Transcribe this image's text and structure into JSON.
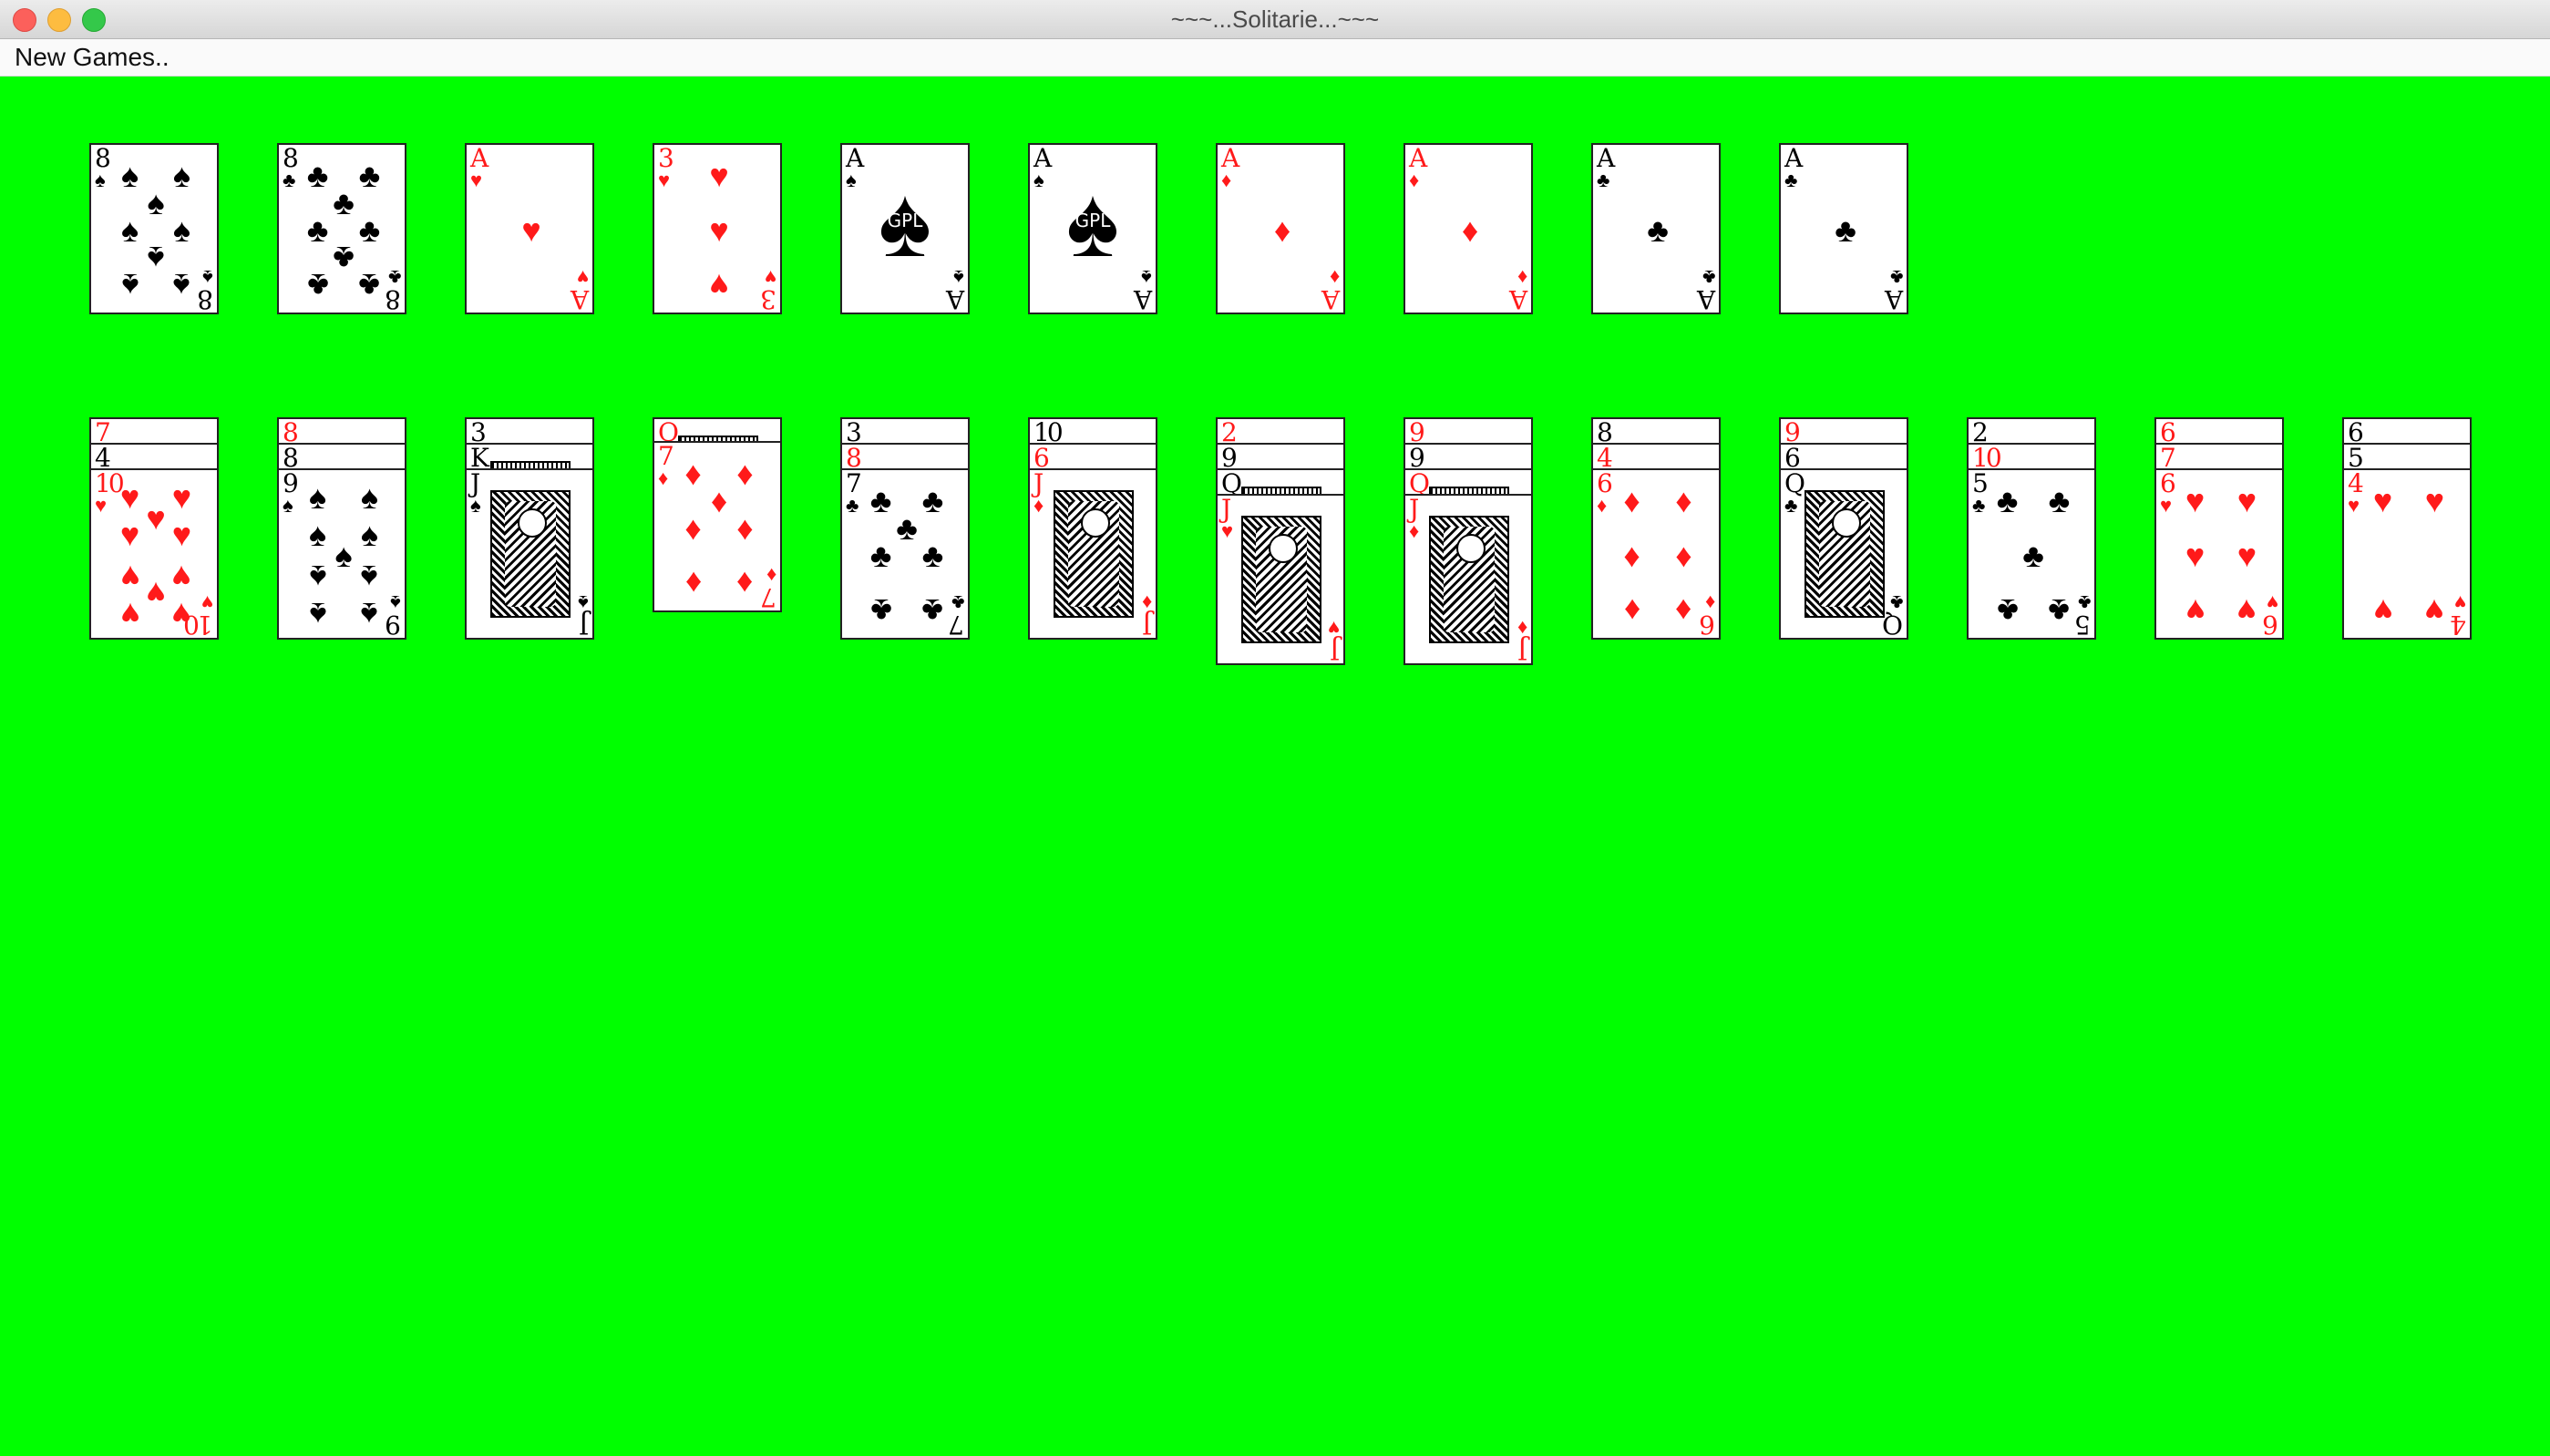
{
  "window": {
    "title": "~~~...Solitarie...~~~"
  },
  "menu": {
    "new_games": "New Games.."
  },
  "colors": {
    "felt": "#00ff00",
    "red_suit": "#ff1a1a",
    "black_suit": "#000000"
  },
  "top_row": [
    {
      "rank": "8",
      "suit": "spades"
    },
    {
      "rank": "8",
      "suit": "clubs"
    },
    {
      "rank": "A",
      "suit": "hearts"
    },
    {
      "rank": "3",
      "suit": "hearts"
    },
    {
      "rank": "A",
      "suit": "spades",
      "logo": "GPL"
    },
    {
      "rank": "A",
      "suit": "spades",
      "logo": "GPL"
    },
    {
      "rank": "A",
      "suit": "diamonds"
    },
    {
      "rank": "A",
      "suit": "diamonds"
    },
    {
      "rank": "A",
      "suit": "clubs"
    },
    {
      "rank": "A",
      "suit": "clubs"
    }
  ],
  "tableau": [
    [
      {
        "rank": "7",
        "suit": "hearts"
      },
      {
        "rank": "4",
        "suit": "spades"
      },
      {
        "rank": "10",
        "suit": "hearts"
      }
    ],
    [
      {
        "rank": "8",
        "suit": "diamonds"
      },
      {
        "rank": "8",
        "suit": "clubs"
      },
      {
        "rank": "9",
        "suit": "spades"
      }
    ],
    [
      {
        "rank": "3",
        "suit": "spades"
      },
      {
        "rank": "K",
        "suit": "clubs"
      },
      {
        "rank": "J",
        "suit": "spades"
      }
    ],
    [
      {
        "rank": "Q",
        "suit": "hearts"
      },
      {
        "rank": "7",
        "suit": "diamonds"
      }
    ],
    [
      {
        "rank": "3",
        "suit": "spades"
      },
      {
        "rank": "8",
        "suit": "hearts"
      },
      {
        "rank": "7",
        "suit": "clubs"
      }
    ],
    [
      {
        "rank": "10",
        "suit": "clubs"
      },
      {
        "rank": "6",
        "suit": "hearts"
      },
      {
        "rank": "J",
        "suit": "diamonds"
      }
    ],
    [
      {
        "rank": "2",
        "suit": "hearts"
      },
      {
        "rank": "9",
        "suit": "clubs"
      },
      {
        "rank": "Q",
        "suit": "spades"
      },
      {
        "rank": "J",
        "suit": "hearts"
      }
    ],
    [
      {
        "rank": "9",
        "suit": "diamonds"
      },
      {
        "rank": "9",
        "suit": "spades"
      },
      {
        "rank": "Q",
        "suit": "diamonds"
      },
      {
        "rank": "J",
        "suit": "diamonds"
      }
    ],
    [
      {
        "rank": "8",
        "suit": "spades"
      },
      {
        "rank": "4",
        "suit": "hearts"
      },
      {
        "rank": "6",
        "suit": "diamonds"
      }
    ],
    [
      {
        "rank": "9",
        "suit": "hearts"
      },
      {
        "rank": "6",
        "suit": "spades"
      },
      {
        "rank": "Q",
        "suit": "clubs"
      }
    ],
    [
      {
        "rank": "2",
        "suit": "clubs"
      },
      {
        "rank": "10",
        "suit": "hearts"
      },
      {
        "rank": "5",
        "suit": "clubs"
      }
    ],
    [
      {
        "rank": "6",
        "suit": "diamonds"
      },
      {
        "rank": "7",
        "suit": "diamonds"
      },
      {
        "rank": "6",
        "suit": "hearts"
      }
    ],
    [
      {
        "rank": "6",
        "suit": "clubs"
      },
      {
        "rank": "5",
        "suit": "clubs"
      },
      {
        "rank": "4",
        "suit": "hearts"
      }
    ]
  ]
}
